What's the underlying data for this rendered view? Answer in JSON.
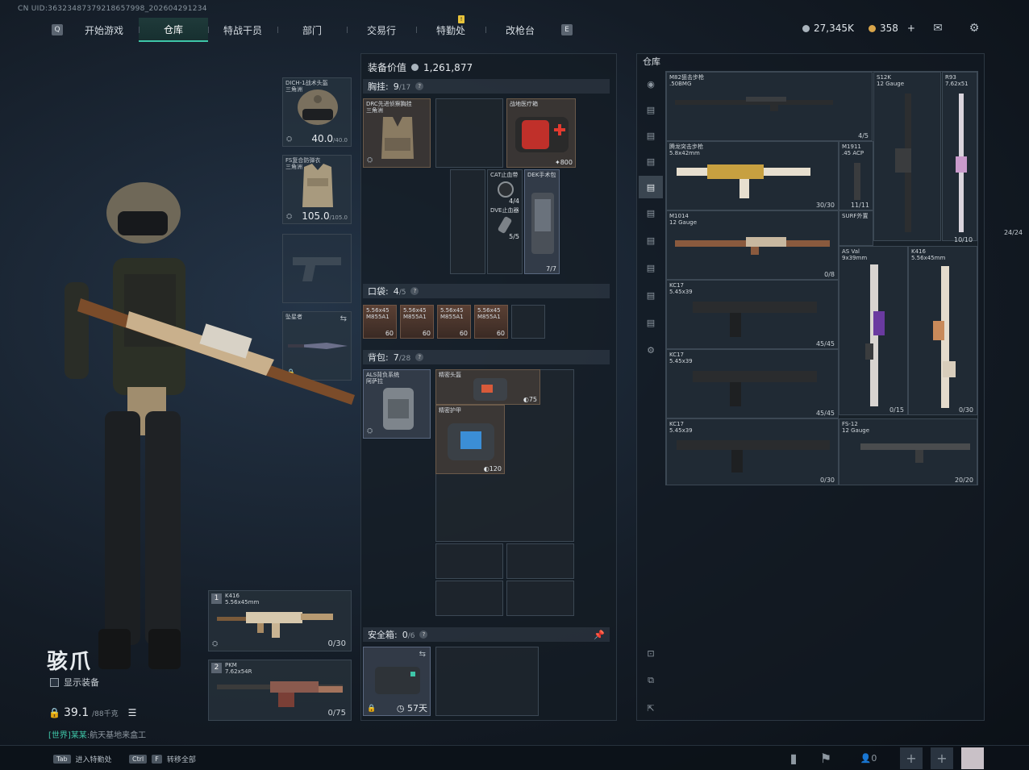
{
  "uid": "CN UID:36323487379218657998_202604291234",
  "nav": {
    "left_key": "Q",
    "right_key": "E",
    "tabs": [
      {
        "label": "开始游戏",
        "active": false
      },
      {
        "label": "仓库",
        "active": true
      },
      {
        "label": "特战干员",
        "active": false
      },
      {
        "label": "部门",
        "active": false
      },
      {
        "label": "交易行",
        "active": false
      },
      {
        "label": "特勤处",
        "active": false,
        "badge": "!"
      },
      {
        "label": "改枪台",
        "active": false
      }
    ]
  },
  "currency": {
    "hafcoin": "27,345K",
    "premium": "358",
    "add": "+"
  },
  "equipment": {
    "helmet": {
      "label": "DICH-1战术头盔\n三角洲",
      "value": "40.0",
      "max": "/40.0"
    },
    "armor": {
      "label": "FS复合防弹衣\n三角洲",
      "value": "105.0",
      "max": "/105.0"
    },
    "melee": {
      "label": "坠星者"
    }
  },
  "character": {
    "name": "骇爪",
    "show_equip": "显示装备",
    "weight": "39.1",
    "weight_max": "/88千克",
    "chat_channel": "[世界]",
    "chat_user": "某某",
    "chat_text": ":航天基地来盒工"
  },
  "weapons": [
    {
      "num": "1",
      "name": "K416\n5.56x45mm",
      "ammo": "0/30"
    },
    {
      "num": "2",
      "name": "PKM\n7.62x54R",
      "ammo": "0/75"
    }
  ],
  "middle": {
    "equip_value_label": "装备价值",
    "equip_value": "1,261,877",
    "chest": {
      "title": "胸挂:",
      "count": "9",
      "max": "/17"
    },
    "chest_items": [
      {
        "label": "DRC先进侦察胸挂\n三角洲"
      },
      {
        "label": "战地医疗箱",
        "qty": "800"
      },
      {
        "label": "CAT止血带",
        "qty": "4/4"
      },
      {
        "label": "DVE止血器",
        "qty": "5/5"
      },
      {
        "label": "DEK手术包",
        "qty": "7/7"
      }
    ],
    "pocket": {
      "title": "口袋:",
      "count": "4",
      "max": "/5"
    },
    "pocket_items": [
      {
        "label": "5.56x45\nM855A1",
        "qty": "60"
      },
      {
        "label": "5.56x45\nM855A1",
        "qty": "60"
      },
      {
        "label": "5.56x45\nM855A1",
        "qty": "60"
      },
      {
        "label": "5.56x45\nM855A1",
        "qty": "60"
      }
    ],
    "backpack": {
      "title": "背包:",
      "count": "7",
      "max": "/28"
    },
    "backpack_items": [
      {
        "label": "ALS背负系统\n阿萨拉"
      },
      {
        "label": "精密头盔",
        "qty": "75"
      },
      {
        "label": "精密护甲",
        "qty": "120"
      }
    ],
    "safe": {
      "title": "安全箱:",
      "count": "0",
      "max": "/6",
      "days": "57天"
    }
  },
  "storage": {
    "title": "仓库",
    "weapons": [
      {
        "name": "M82狙击步枪\n.50BMG",
        "ammo": "4/5"
      },
      {
        "name": "S12K\n12 Gauge",
        "ammo": ""
      },
      {
        "name": "R93\n7.62x51",
        "ammo": ""
      },
      {
        "name": "腾龙突击步枪\n5.8x42mm",
        "ammo": "30/30"
      },
      {
        "name": "M1911\n.45 ACP",
        "ammo": "11/11"
      },
      {
        "name": "SURF外置",
        "ammo": ""
      },
      {
        "name": "M1014\n12 Gauge",
        "ammo": "0/8"
      },
      {
        "name": "AS Val\n9x39mm",
        "ammo": "24/24"
      },
      {
        "name": "K416\n5.56x45mm",
        "ammo": "10/10"
      },
      {
        "name": "KC17\n5.45x39",
        "ammo": "45/45"
      },
      {
        "name": "KC17\n5.45x39",
        "ammo": "45/45"
      },
      {
        "name": "KC17\n5.45x39",
        "ammo": "0/30"
      },
      {
        "name": "FS-12\n12 Gauge",
        "ammo": "20/20"
      },
      {
        "name": "AS Val\n9x39mm",
        "ammo": "0/15"
      },
      {
        "name": "K416\n5.56x45mm",
        "ammo": "0/30"
      }
    ]
  },
  "bottom": {
    "hint1_key": "Tab",
    "hint1": "进入特勤处",
    "hint2_key1": "Ctrl",
    "hint2_key2": "F",
    "hint2": "转移全部",
    "party_count": "0"
  }
}
